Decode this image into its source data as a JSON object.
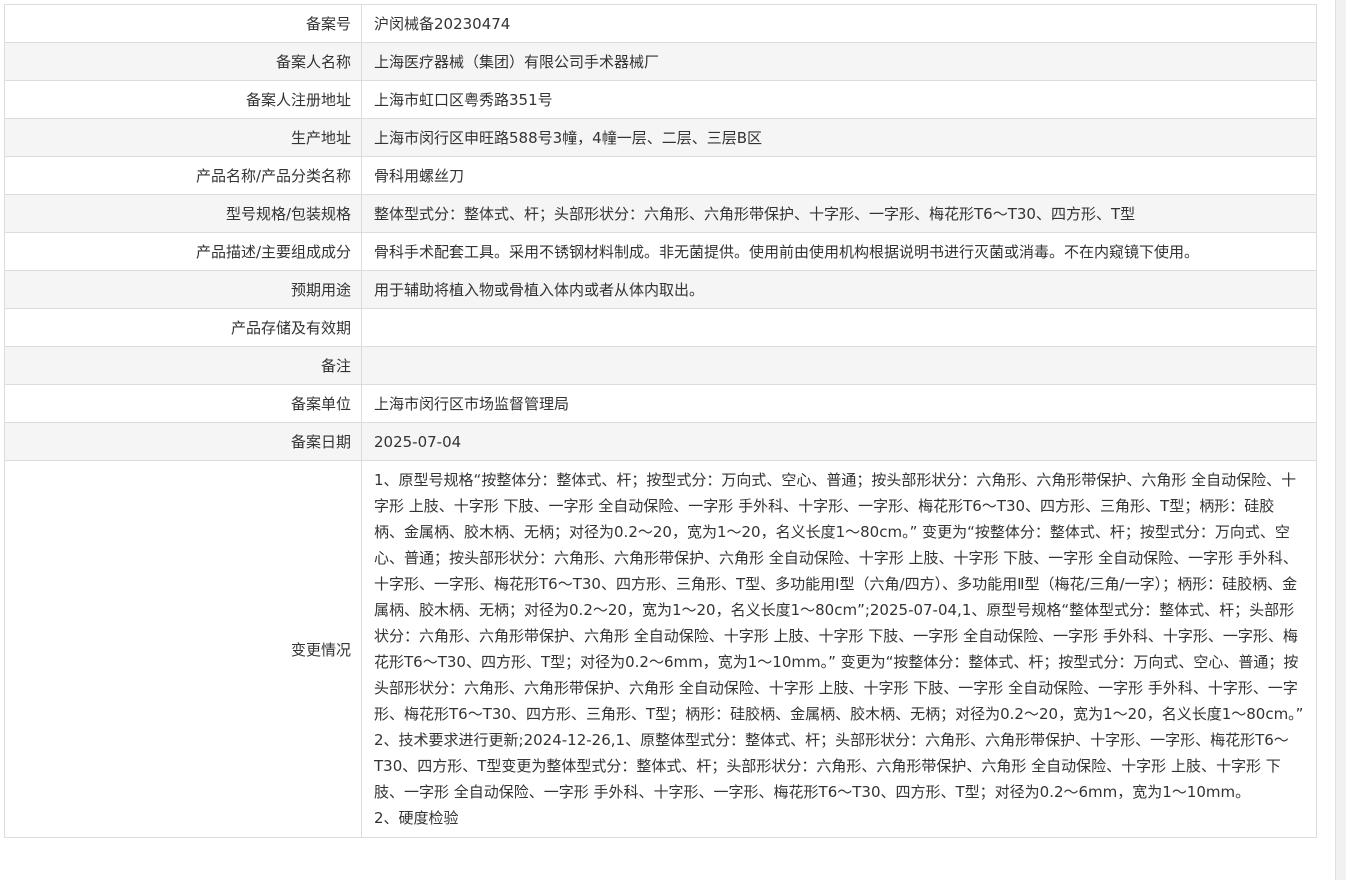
{
  "rows": [
    {
      "label": "备案号",
      "value": "沪闵械备20230474"
    },
    {
      "label": "备案人名称",
      "value": "上海医疗器械（集团）有限公司手术器械厂"
    },
    {
      "label": "备案人注册地址",
      "value": "上海市虹口区粤秀路351号"
    },
    {
      "label": "生产地址",
      "value": "上海市闵行区申旺路588号3幢，4幢一层、二层、三层B区"
    },
    {
      "label": "产品名称/产品分类名称",
      "value": "骨科用螺丝刀"
    },
    {
      "label": "型号规格/包装规格",
      "value": "整体型式分：整体式、杆；头部形状分：六角形、六角形带保护、十字形、一字形、梅花形T6～T30、四方形、T型"
    },
    {
      "label": "产品描述/主要组成成分",
      "value": "骨科手术配套工具。采用不锈钢材料制成。非无菌提供。使用前由使用机构根据说明书进行灭菌或消毒。不在内窥镜下使用。"
    },
    {
      "label": "预期用途",
      "value": "用于辅助将植入物或骨植入体内或者从体内取出。"
    },
    {
      "label": "产品存储及有效期",
      "value": ""
    },
    {
      "label": "备注",
      "value": ""
    },
    {
      "label": "备案单位",
      "value": "上海市闵行区市场监督管理局"
    },
    {
      "label": "备案日期",
      "value": "2025-07-04"
    }
  ],
  "changes": {
    "label": "变更情况",
    "lines": [
      "1、原型号规格“按整体分：整体式、杆；按型式分：万向式、空心、普通；按头部形状分：六角形、六角形带保护、六角形 全自动保险、十字形 上肢、十字形 下肢、一字形 全自动保险、一字形 手外科、十字形、一字形、梅花形T6～T30、四方形、三角形、T型；柄形：硅胶柄、金属柄、胶木柄、无柄；对径为0.2～20，宽为1～20，名义长度1～80cm。” 变更为“按整体分：整体式、杆；按型式分：万向式、空心、普通；按头部形状分：六角形、六角形带保护、六角形 全自动保险、十字形 上肢、十字形 下肢、一字形 全自动保险、一字形 手外科、十字形、一字形、梅花形T6～T30、四方形、三角形、T型、多功能用Ⅰ型（六角/四方）、多功能用Ⅱ型（梅花/三角/一字）；柄形：硅胶柄、金属柄、胶木柄、无柄；对径为0.2～20，宽为1～20，名义长度1～80cm”;2025-07-04,1、原型号规格“整体型式分：整体式、杆；头部形状分：六角形、六角形带保护、六角形 全自动保险、十字形 上肢、十字形 下肢、一字形 全自动保险、一字形 手外科、十字形、一字形、梅花形T6～T30、四方形、T型；对径为0.2～6mm，宽为1～10mm。” 变更为“按整体分：整体式、杆；按型式分：万向式、空心、普通；按头部形状分：六角形、六角形带保护、六角形 全自动保险、十字形 上肢、十字形 下肢、一字形 全自动保险、一字形 手外科、十字形、一字形、梅花形T6～T30、四方形、三角形、T型；柄形：硅胶柄、金属柄、胶木柄、无柄；对径为0.2～20，宽为1～20，名义长度1～80cm。”",
      "2、技术要求进行更新;2024-12-26,1、原整体型式分：整体式、杆；头部形状分：六角形、六角形带保护、十字形、一字形、梅花形T6～T30、四方形、T型变更为整体型式分：整体式、杆；头部形状分：六角形、六角形带保护、六角形 全自动保险、十字形 上肢、十字形 下肢、一字形 全自动保险、一字形 手外科、十字形、一字形、梅花形T6～T30、四方形、T型；对径为0.2～6mm，宽为1～10mm。",
      "2、硬度检验"
    ]
  }
}
